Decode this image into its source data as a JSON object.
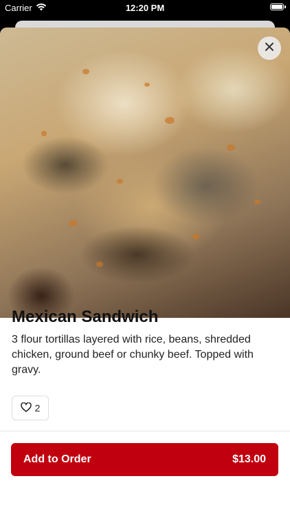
{
  "status_bar": {
    "carrier": "Carrier",
    "time": "12:20 PM",
    "icons": [
      "wifi-icon",
      "battery-icon"
    ]
  },
  "item": {
    "image": "food-photo",
    "name": "Mexican Sandwich",
    "description": "3 flour tortillas layered with rice, beans, shredded chicken, ground beef or chunky beef. Topped with gravy.",
    "likes": "2"
  },
  "actions": {
    "close_icon": "close-icon",
    "like_icon": "heart-icon",
    "add_label": "Add to Order",
    "price": "$13.00"
  },
  "colors": {
    "accent": "#c1000f",
    "text": "#111111"
  }
}
